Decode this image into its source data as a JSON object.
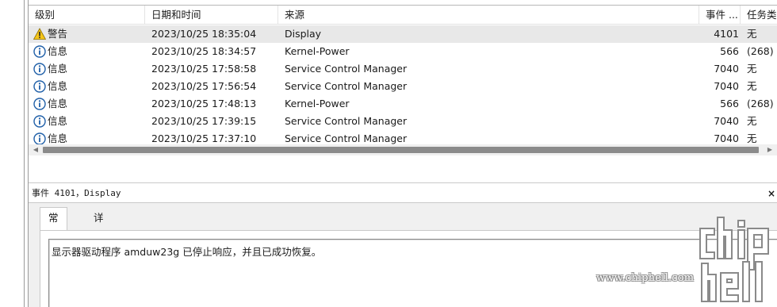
{
  "columns": {
    "level": "级别",
    "date": "日期和时间",
    "source": "来源",
    "event_id": "事件 ...",
    "task": "任务类"
  },
  "events": [
    {
      "level": "警告",
      "level_icon": "warning-icon",
      "date": "2023/10/25 18:35:04",
      "source": "Display",
      "event_id": "4101",
      "task": "无"
    },
    {
      "level": "信息",
      "level_icon": "info-icon",
      "date": "2023/10/25 18:34:57",
      "source": "Kernel-Power",
      "event_id": "566",
      "task": "(268)"
    },
    {
      "level": "信息",
      "level_icon": "info-icon",
      "date": "2023/10/25 17:58:58",
      "source": "Service Control Manager",
      "event_id": "7040",
      "task": "无"
    },
    {
      "level": "信息",
      "level_icon": "info-icon",
      "date": "2023/10/25 17:56:54",
      "source": "Service Control Manager",
      "event_id": "7040",
      "task": "无"
    },
    {
      "level": "信息",
      "level_icon": "info-icon",
      "date": "2023/10/25 17:48:13",
      "source": "Kernel-Power",
      "event_id": "566",
      "task": "(268)"
    },
    {
      "level": "信息",
      "level_icon": "info-icon",
      "date": "2023/10/25 17:39:15",
      "source": "Service Control Manager",
      "event_id": "7040",
      "task": "无"
    },
    {
      "level": "信息",
      "level_icon": "info-icon",
      "date": "2023/10/25 17:37:10",
      "source": "Service Control Manager",
      "event_id": "7040",
      "task": "无"
    }
  ],
  "detail": {
    "header": "事件 4101，Display",
    "close_glyph": "×",
    "tabs": [
      "常规",
      "详细信息"
    ],
    "message": "显示器驱动程序 amduw23g 已停止响应，并且已成功恢复。"
  },
  "scrollbar": {
    "left_arrow": "◀",
    "right_arrow": "▶"
  },
  "watermark": {
    "url": "www.chiphell.com",
    "logo_text": "chip hell"
  },
  "colors": {
    "warning": "#f5c518",
    "info": "#1f5fa8",
    "selected_row": "#e8e8e8"
  }
}
